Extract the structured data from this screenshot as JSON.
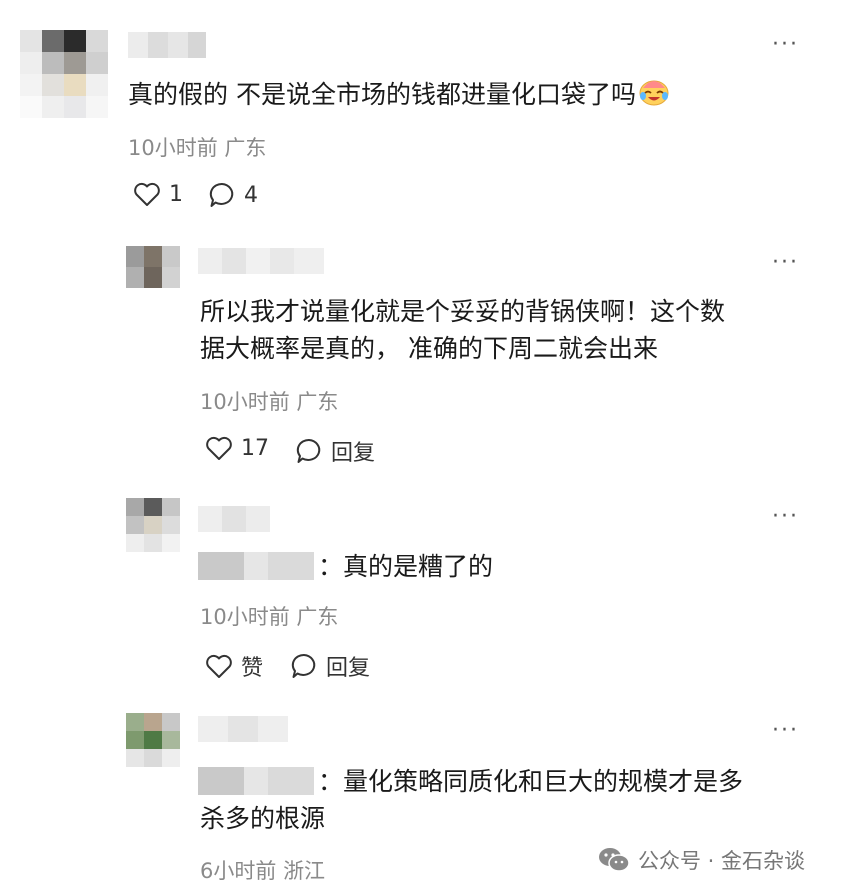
{
  "comments": [
    {
      "text": "真的假的 不是说全市场的钱都进量化口袋了吗",
      "emoji": "crying-laughing-emoji",
      "time": "10小时前",
      "location": "广东",
      "likes": "1",
      "replies": "4"
    },
    {
      "text_line1": "所以我才说量化就是个妥妥的背锅侠啊！这个数",
      "text_line2": "据大概率是真的， 准确的下周二就会出来",
      "time": "10小时前",
      "location": "广东",
      "likes": "17",
      "reply_label": "回复"
    },
    {
      "text": "：真的是糟了的",
      "time": "10小时前",
      "location": "广东",
      "like_label": "赞",
      "reply_label": "回复"
    },
    {
      "text_line1": "：量化策略同质化和巨大的规模才是多",
      "text_line2": "杀多的根源",
      "time": "6小时前",
      "location": "浙江"
    }
  ],
  "watermark": {
    "prefix": "公众号 · ",
    "name": "金石杂谈"
  },
  "more_label": "···"
}
